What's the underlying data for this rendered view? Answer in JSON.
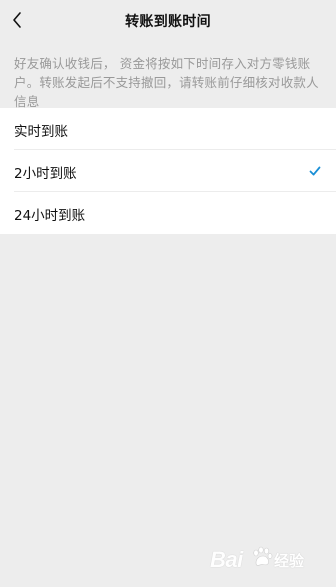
{
  "nav": {
    "title": "转账到账时间"
  },
  "description": "好友确认收钱后， 资金将按如下时间存入对方零钱账户。转账发起后不支持撤回，请转账前仔细核对收款人信息",
  "options": [
    {
      "label": "实时到账",
      "selected": false
    },
    {
      "label": "2小时到账",
      "selected": true
    },
    {
      "label": "24小时到账",
      "selected": false
    }
  ],
  "colors": {
    "background": "#ededed",
    "check": "#1aad19",
    "description": "#999999"
  },
  "watermark": {
    "text": "Bai",
    "suffix": "经验"
  },
  "icons": {
    "back": "chevron-left-icon",
    "check": "checkmark-icon",
    "watermark": "paw-icon"
  }
}
